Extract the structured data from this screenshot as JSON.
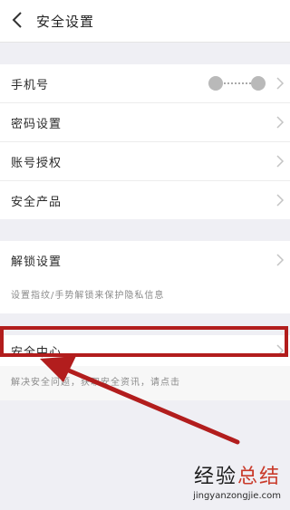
{
  "header": {
    "title": "安全设置"
  },
  "group1": [
    {
      "label": "手机号"
    },
    {
      "label": "密码设置"
    },
    {
      "label": "账号授权"
    },
    {
      "label": "安全产品"
    }
  ],
  "group2": {
    "label": "解锁设置",
    "hint": "设置指纹/手势解锁来保护隐私信息"
  },
  "group3": {
    "label": "安全中心",
    "hint": "解决安全问题，获取安全资讯，请点击"
  },
  "watermark": {
    "brand_part1": "经验",
    "brand_part2": "总结",
    "url": "jingyanzongjie.com"
  },
  "colors": {
    "highlight": "#b21d1d",
    "background": "#efeff4",
    "accent": "#c93a2a"
  }
}
